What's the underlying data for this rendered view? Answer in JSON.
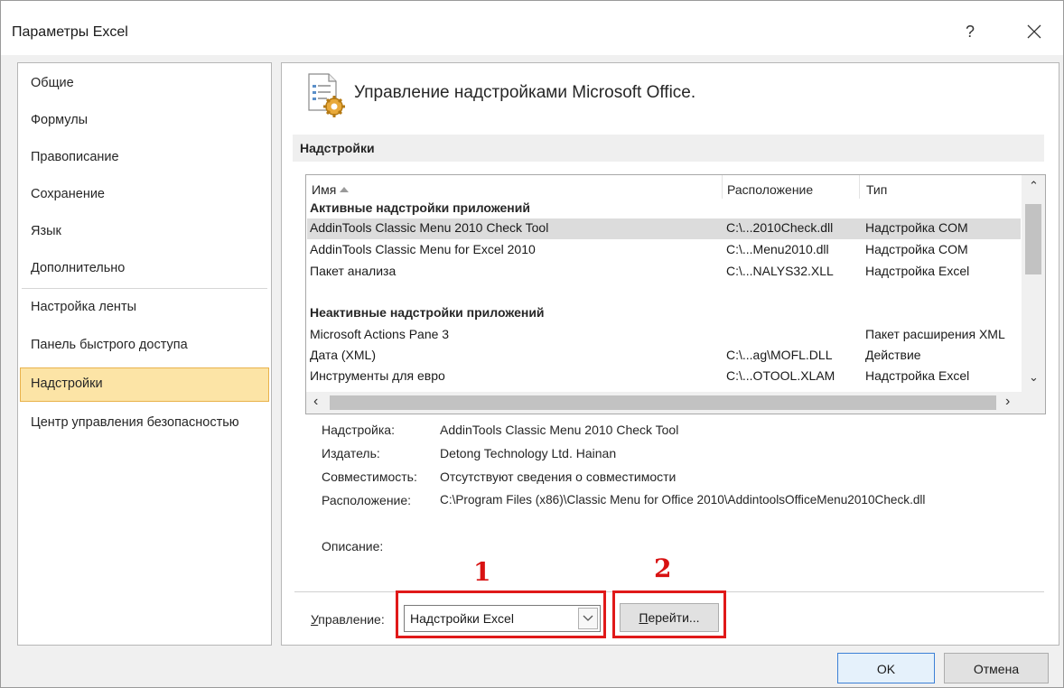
{
  "window": {
    "title": "Параметры Excel",
    "help_label": "?",
    "close_icon": "close-icon"
  },
  "sidebar": {
    "items": [
      {
        "label": "Общие"
      },
      {
        "label": "Формулы"
      },
      {
        "label": "Правописание"
      },
      {
        "label": "Сохранение"
      },
      {
        "label": "Язык"
      },
      {
        "label": "Дополнительно"
      },
      {
        "label": "Настройка ленты"
      },
      {
        "label": "Панель быстрого доступа"
      },
      {
        "label": "Надстройки",
        "active": true
      },
      {
        "label": "Центр управления безопасностью"
      }
    ]
  },
  "main": {
    "header_title": "Управление надстройками Microsoft Office.",
    "section_title": "Надстройки",
    "columns": {
      "name": "Имя",
      "location": "Расположение",
      "type": "Тип"
    },
    "groups": [
      {
        "title": "Активные надстройки приложений",
        "rows": [
          {
            "name": "AddinTools Classic Menu 2010 Check Tool",
            "location": "C:\\...2010Check.dll",
            "type": "Надстройка COM",
            "selected": true
          },
          {
            "name": "AddinTools Classic Menu for Excel 2010",
            "location": "C:\\...Menu2010.dll",
            "type": "Надстройка COM"
          },
          {
            "name": "Пакет анализа",
            "location": "C:\\...NALYS32.XLL",
            "type": "Надстройка Excel"
          }
        ]
      },
      {
        "title": "Неактивные надстройки приложений",
        "rows": [
          {
            "name": "Microsoft Actions Pane 3",
            "location": "",
            "type": "Пакет расширения XML"
          },
          {
            "name": "Дата (XML)",
            "location": "C:\\...ag\\MOFL.DLL",
            "type": "Действие"
          },
          {
            "name": "Инструменты для евро",
            "location": "C:\\...OTOOL.XLAM",
            "type": "Надстройка Excel"
          }
        ]
      }
    ],
    "details": {
      "addin_label": "Надстройка:",
      "addin_value": "AddinTools Classic Menu 2010 Check Tool",
      "publisher_label": "Издатель:",
      "publisher_value": "Detong Technology Ltd. Hainan",
      "compat_label": "Совместимость:",
      "compat_value": "Отсутствуют сведения о совместимости",
      "location_label": "Расположение:",
      "location_value": "C:\\Program Files (x86)\\Classic Menu for Office 2010\\AddintoolsOfficeMenu2010Check.dll",
      "description_label": "Описание:"
    },
    "manage": {
      "label": "Управление:",
      "selected": "Надстройки Excel",
      "go_label": "Перейти..."
    },
    "annotations": {
      "first": "1",
      "second": "2",
      "color": "#e01919"
    }
  },
  "footer": {
    "ok_label": "OK",
    "cancel_label": "Отмена"
  }
}
